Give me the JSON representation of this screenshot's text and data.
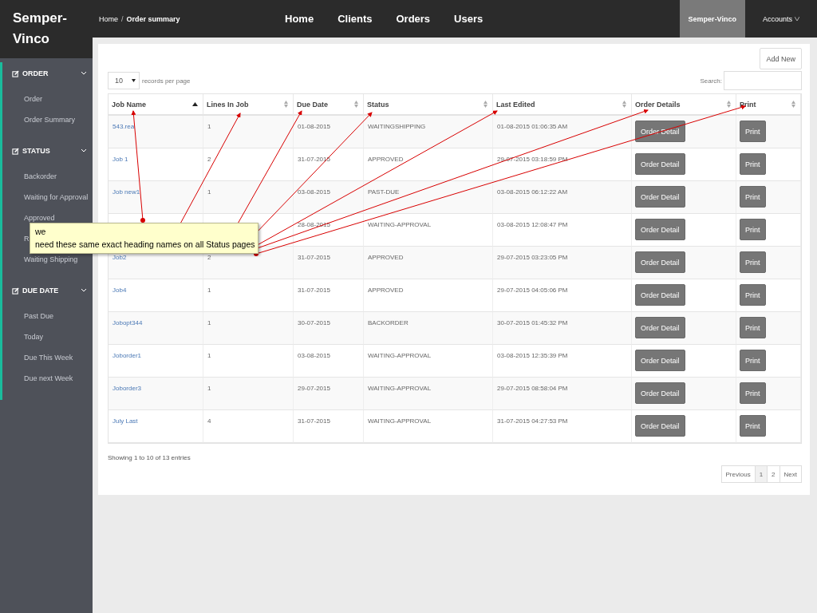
{
  "brand": "Semper-Vinco",
  "breadcrumb_separator": "/",
  "breadcrumb": [
    {
      "label": "Home",
      "current": false
    },
    {
      "label": "Order summary",
      "current": true
    }
  ],
  "nav": [
    "Home",
    "Clients",
    "Orders",
    "Users"
  ],
  "user_menu": [
    {
      "label": "Semper-Vinco",
      "selected": true,
      "dropdown": false
    },
    {
      "label": "Accounts",
      "selected": false,
      "dropdown": true
    }
  ],
  "sidebar": [
    {
      "label": "ORDER",
      "expanded": true,
      "children": [
        {
          "label": "Order"
        },
        {
          "label": "Order Summary"
        }
      ]
    },
    {
      "label": "STATUS",
      "expanded": true,
      "children": [
        {
          "label": "Backorder"
        },
        {
          "label": "Waiting for Approval"
        },
        {
          "label": "Approved"
        },
        {
          "label": "R"
        },
        {
          "label": "Waiting Shipping"
        }
      ]
    },
    {
      "label": "DUE DATE",
      "expanded": true,
      "children": [
        {
          "label": "Past Due"
        },
        {
          "label": "Today"
        },
        {
          "label": "Due This Week"
        },
        {
          "label": "Due next Week"
        }
      ]
    }
  ],
  "add_button": "Add New",
  "page_size": {
    "value": "10",
    "label": "records per page"
  },
  "search": {
    "label": "Search:"
  },
  "table": {
    "columns": [
      {
        "label": "Job Name",
        "sorted": true
      },
      {
        "label": "Lines In Job",
        "sorted": false
      },
      {
        "label": "Due Date",
        "sorted": false
      },
      {
        "label": "Status",
        "sorted": false
      },
      {
        "label": "Last Edited",
        "sorted": false
      },
      {
        "label": "Order Details",
        "sorted": false
      },
      {
        "label": "Print",
        "sorted": false
      }
    ],
    "rows": [
      {
        "job": "543.rea",
        "lines": "1",
        "due": "01-08-2015",
        "status": "WAITINGSHIPPING",
        "edited": "01-08-2015 01:06:35 AM",
        "detail": "Order Detail",
        "print": "Print"
      },
      {
        "job": "Job 1",
        "lines": "2",
        "due": "31-07-2015",
        "status": "APPROVED",
        "edited": "29-07-2015 03:18:59 PM",
        "detail": "Order Detail",
        "print": "Print"
      },
      {
        "job": "Job new1",
        "lines": "1",
        "due": "03-08-2015",
        "status": "PAST-DUE",
        "edited": "03-08-2015 06:12:22 AM",
        "detail": "Order Detail",
        "print": "Print"
      },
      {
        "due": "28-08-2015",
        "status": "WAITING-APPROVAL",
        "edited": "03-08-2015 12:08:47 PM",
        "detail": "Order Detail",
        "print": "Print"
      },
      {
        "job": "Job2",
        "lines": "2",
        "due": "31-07-2015",
        "status": "APPROVED",
        "edited": "29-07-2015 03:23:05 PM",
        "detail": "Order Detail",
        "print": "Print"
      },
      {
        "job": "Job4",
        "lines": "1",
        "due": "31-07-2015",
        "status": "APPROVED",
        "edited": "29-07-2015 04:05:06 PM",
        "detail": "Order Detail",
        "print": "Print"
      },
      {
        "job": "Jobopt344",
        "lines": "1",
        "due": "30-07-2015",
        "status": "BACKORDER",
        "edited": "30-07-2015 01:45:32 PM",
        "detail": "Order Detail",
        "print": "Print"
      },
      {
        "job": "Joborder1",
        "lines": "1",
        "due": "03-08-2015",
        "status": "WAITING-APPROVAL",
        "edited": "03-08-2015 12:35:39 PM",
        "detail": "Order Detail",
        "print": "Print"
      },
      {
        "job": "Joborder3",
        "lines": "1",
        "due": "29-07-2015",
        "status": "WAITING-APPROVAL",
        "edited": "29-07-2015 08:58:04 PM",
        "detail": "Order Detail",
        "print": "Print"
      },
      {
        "job": "July Last",
        "lines": "4",
        "due": "31-07-2015",
        "status": "WAITING-APPROVAL",
        "edited": "31-07-2015 04:27:53 PM",
        "detail": "Order Detail",
        "print": "Print"
      }
    ]
  },
  "info": "Showing 1 to 10 of 13 entries",
  "pagination": [
    {
      "label": "Previous",
      "selected": false
    },
    {
      "label": "1",
      "selected": true
    },
    {
      "label": "2",
      "selected": false
    },
    {
      "label": "Next",
      "selected": false
    }
  ],
  "callout": {
    "lines": [
      "we",
      "need these same exact heading names on all Status pages"
    ]
  }
}
